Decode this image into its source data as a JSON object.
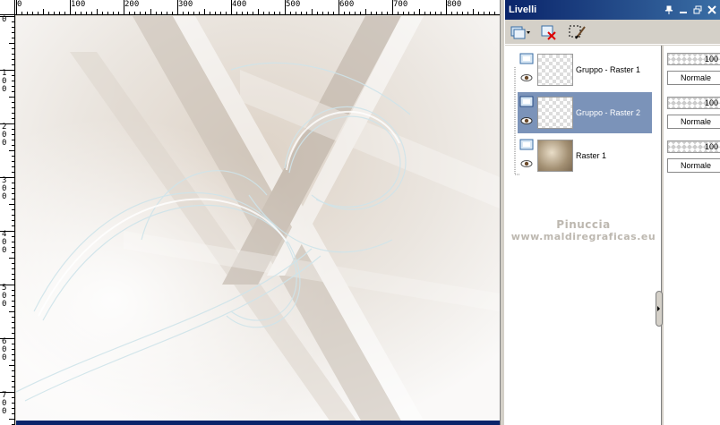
{
  "ruler": {
    "top_labels": [
      "0",
      "100",
      "200",
      "300",
      "400",
      "500",
      "600",
      "700",
      "800"
    ],
    "left_labels": [
      "0",
      "1\n0\n0",
      "2\n0\n0",
      "3\n0\n0",
      "4\n0\n0",
      "5\n0\n0",
      "6\n0\n0",
      "7\n0\n0"
    ]
  },
  "palette": {
    "title": "Livelli",
    "pin_icon": "pin-icon",
    "layers": [
      {
        "name": "Gruppo - Raster 1",
        "opacity": "100",
        "blend": "Normale",
        "selected": false
      },
      {
        "name": "Gruppo - Raster 2",
        "opacity": "100",
        "blend": "Normale",
        "selected": true
      },
      {
        "name": "Raster 1",
        "opacity": "100",
        "blend": "Normale",
        "selected": false
      }
    ],
    "watermark_line1": "Pinuccia",
    "watermark_line2": "www.maldiregraficas.eu"
  },
  "colors": {
    "title_bar": "#0a246a",
    "selected_layer": "#7b93b9"
  }
}
